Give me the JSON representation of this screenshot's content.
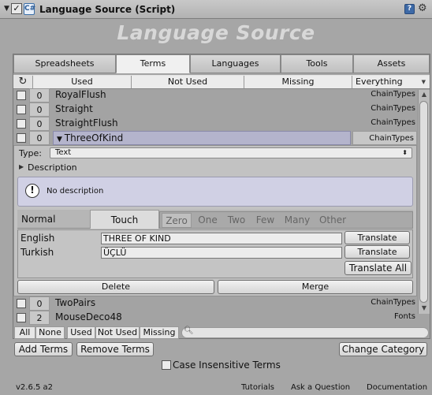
{
  "header": {
    "title": "Language Source (Script)",
    "script_glyph": "C#"
  },
  "big_title": "Language Source",
  "main_tabs": [
    "Spreadsheets",
    "Terms",
    "Languages",
    "Tools",
    "Assets"
  ],
  "active_tab": "Terms",
  "filter": {
    "used": "Used",
    "not_used": "Not Used",
    "missing": "Missing",
    "select": "Everything"
  },
  "terms": [
    {
      "count": "0",
      "name": "RoyalFlush",
      "category": "ChainTypes"
    },
    {
      "count": "0",
      "name": "Straight",
      "category": "ChainTypes"
    },
    {
      "count": "0",
      "name": "StraightFlush",
      "category": "ChainTypes"
    },
    {
      "count": "0",
      "name": "ThreeOfKind",
      "category": "ChainTypes"
    },
    {
      "count": "0",
      "name": "TwoPairs",
      "category": "ChainTypes"
    },
    {
      "count": "2",
      "name": "MouseDeco48",
      "category": "Fonts"
    }
  ],
  "detail": {
    "type_label": "Type:",
    "type_value": "Text",
    "description_label": "Description",
    "description_text": "No description",
    "lang_tabs": [
      "Normal",
      "Touch"
    ],
    "plural_tabs": [
      "Zero",
      "One",
      "Two",
      "Few",
      "Many",
      "Other"
    ],
    "translations": [
      {
        "language": "English",
        "value": "THREE OF KIND",
        "button": "Translate"
      },
      {
        "language": "Turkish",
        "value": "ÜÇLÜ",
        "button": "Translate"
      }
    ],
    "translate_all": "Translate All",
    "delete": "Delete",
    "merge": "Merge"
  },
  "category_filter": [
    "All",
    "None",
    "Used",
    "Not Used",
    "Missing"
  ],
  "actions": {
    "add_terms": "Add Terms",
    "remove_terms": "Remove Terms",
    "change_category": "Change Category"
  },
  "case_insensitive": "Case Insensitive Terms",
  "footer": {
    "version": "v2.6.5 a2",
    "links": [
      "Tutorials",
      "Ask a Question",
      "Documentation"
    ]
  },
  "colors": {
    "selected_row": "#b4b4cc",
    "description_bg": "#d0d0e4",
    "panel_bg": "#a6a6a6"
  }
}
